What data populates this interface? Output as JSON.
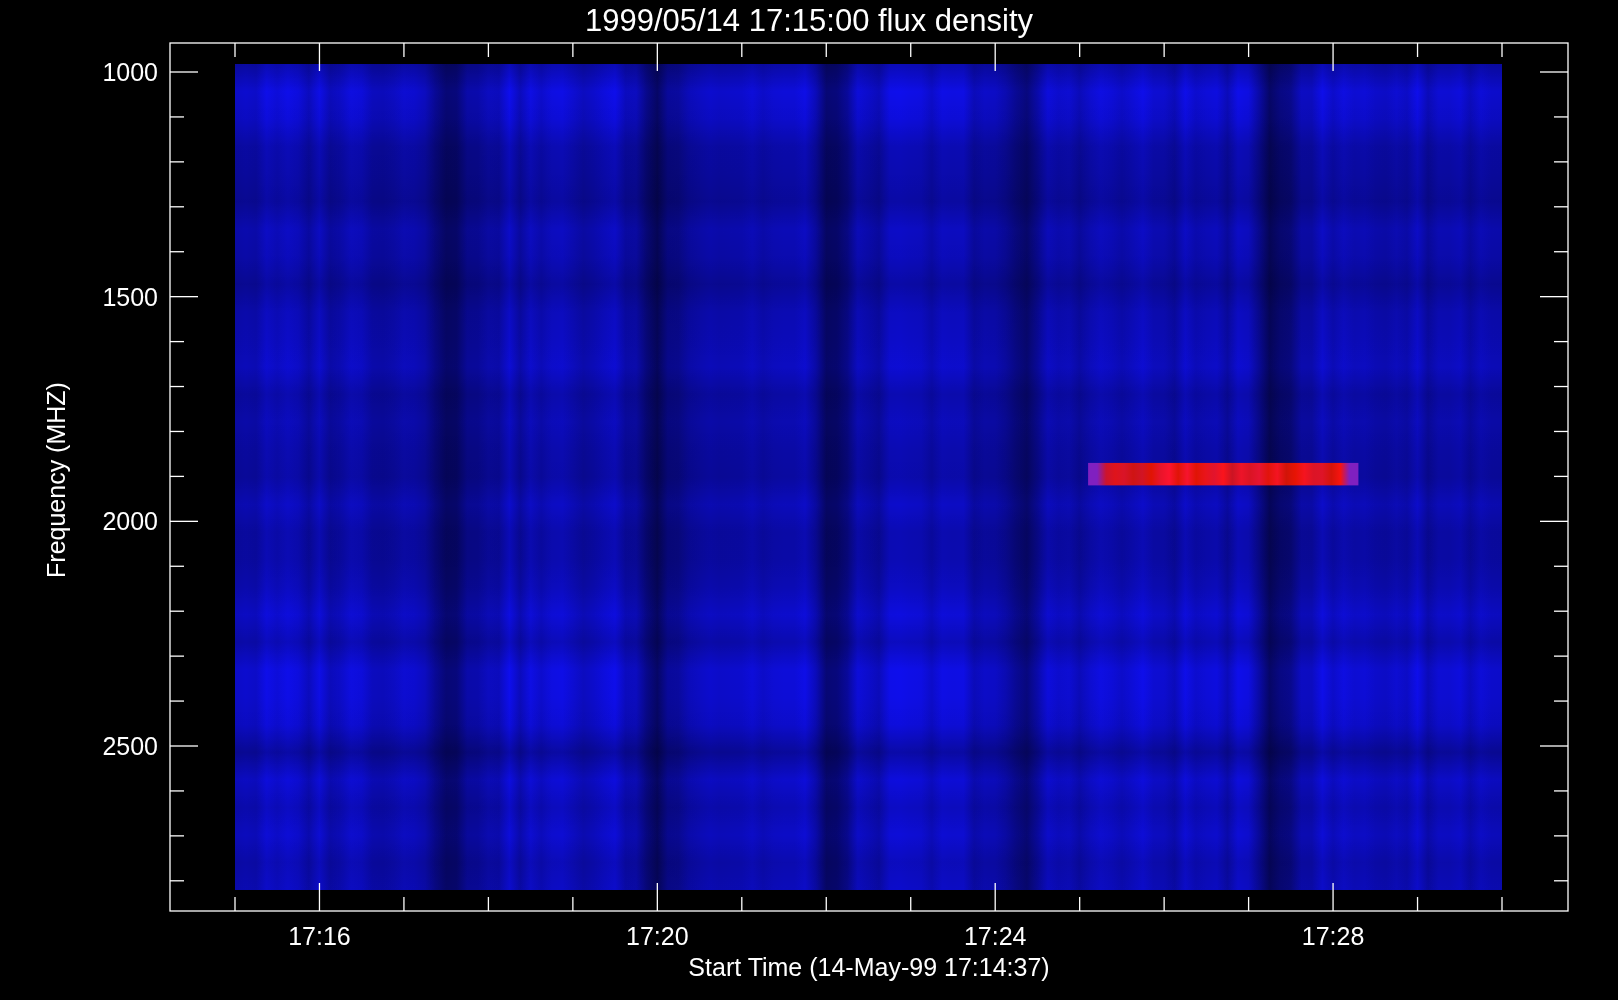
{
  "plot": {
    "title": "1999/05/14 17:15:00 flux density",
    "x_axis": {
      "label": "Start Time (14-May-99 17:14:37)",
      "tick_labels": [
        "17:16",
        "17:20",
        "17:24",
        "17:28"
      ]
    },
    "y_axis": {
      "label": "Frequency (MHZ)",
      "tick_labels": [
        "1000",
        "1500",
        "2000",
        "2500"
      ]
    }
  }
}
